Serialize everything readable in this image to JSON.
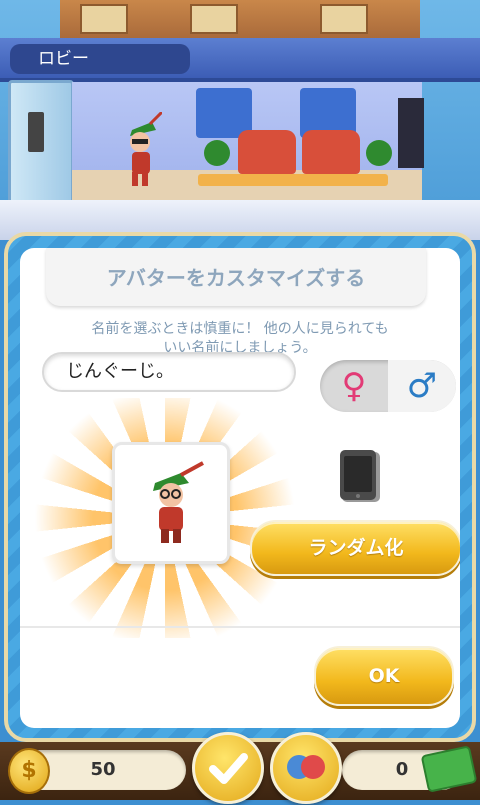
{
  "scene": {
    "floor_label": "ロビー"
  },
  "dialog": {
    "title": "アバターをカスタマイズする",
    "subtitle_line1": "名前を選ぶときは慎重に！ 他の人に見られても",
    "subtitle_line2": "いい名前にしましょう。",
    "name_value": "じんぐーじ。",
    "gender_female_symbol": "♀",
    "gender_male_symbol": "♂",
    "gender_selected": "male",
    "random_button": "ランダム化",
    "ok_button": "OK"
  },
  "hud": {
    "coins": "50",
    "coin_symbol": "$",
    "cash": "0"
  },
  "colors": {
    "button_gold": "#f2b81c",
    "dialog_blue": "#4aa9e3",
    "female_pink": "#e23b76",
    "male_blue": "#2b7cc5"
  },
  "icons": [
    "phone-icon",
    "coin-icon",
    "cash-icon",
    "checkmark-icon",
    "social-icon"
  ]
}
